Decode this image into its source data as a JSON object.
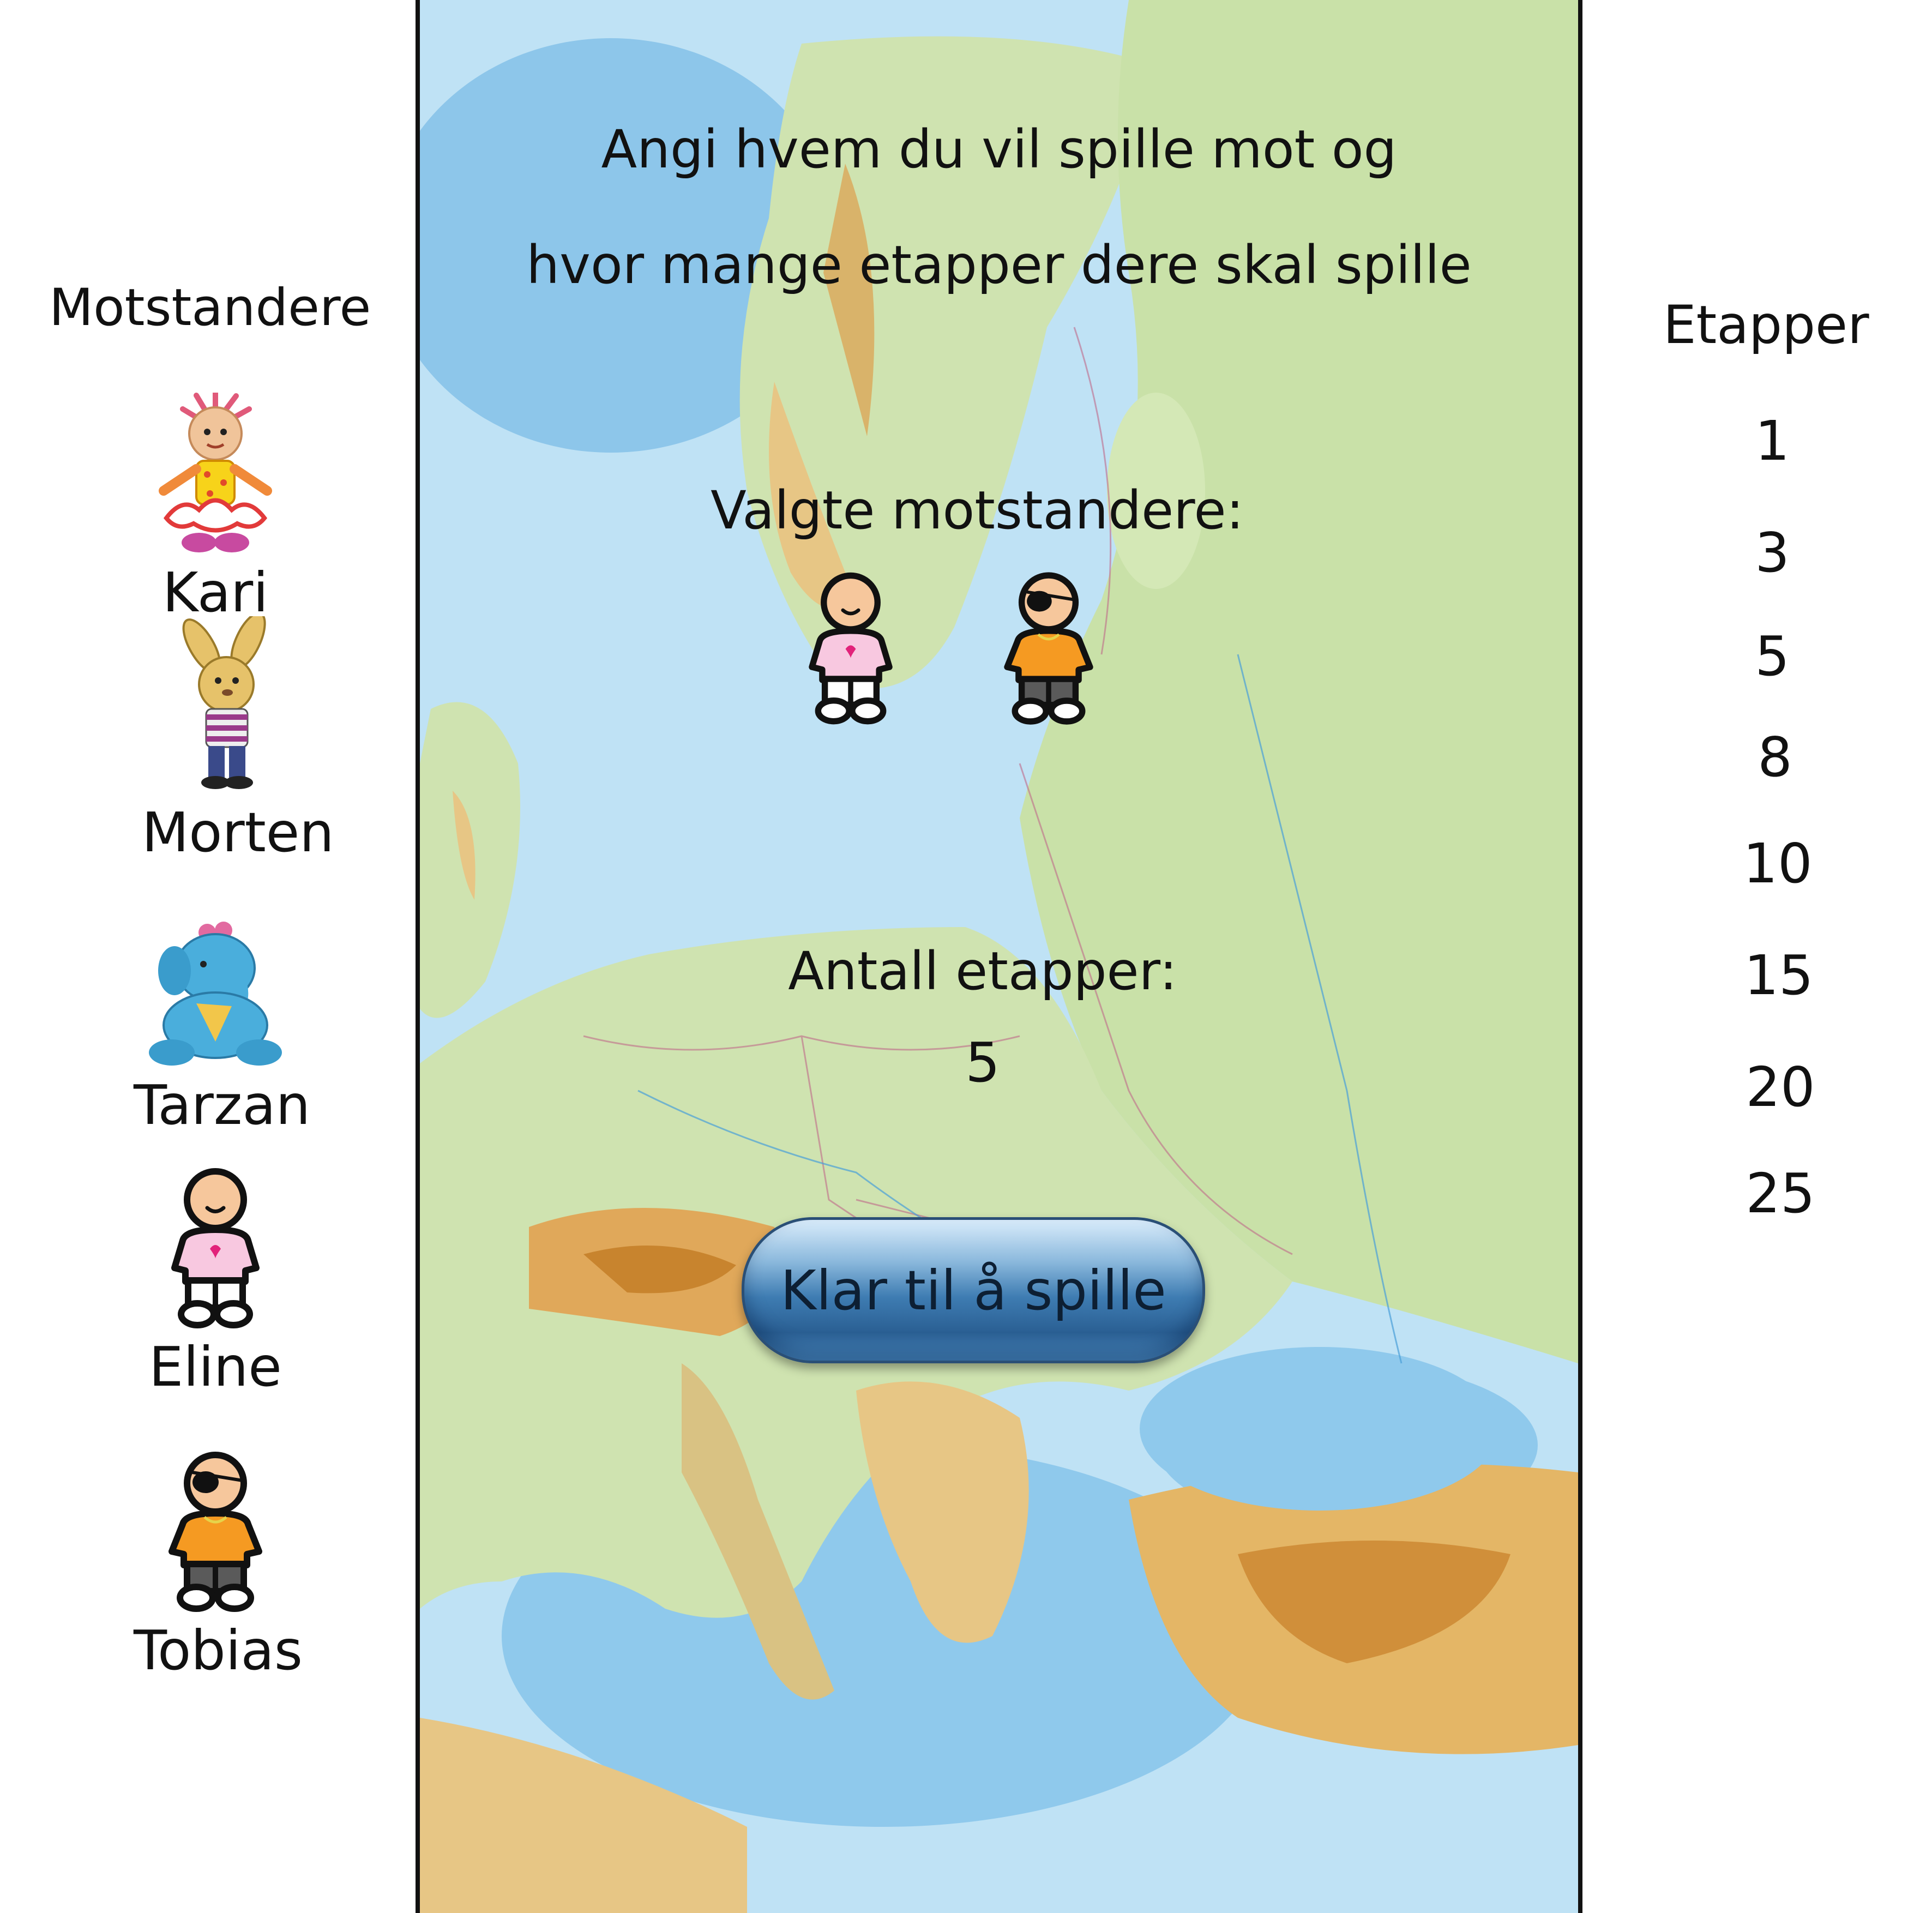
{
  "opponents_panel": {
    "title": "Motstandere",
    "opponents": [
      {
        "name": "Kari",
        "avatar": "doll-girl-icon"
      },
      {
        "name": "Morten",
        "avatar": "rabbit-icon"
      },
      {
        "name": "Tarzan",
        "avatar": "blue-elephant-icon"
      },
      {
        "name": "Eline",
        "avatar": "girl-pictogram-icon"
      },
      {
        "name": "Tobias",
        "avatar": "boy-eyepatch-pictogram-icon"
      }
    ]
  },
  "center": {
    "instruction_line1": "Angi hvem du vil spille mot og",
    "instruction_line2": "hvor mange etapper dere skal spille",
    "selected_title": "Valgte motstandere:",
    "selected_opponents": [
      "girl-pictogram-icon",
      "boy-eyepatch-pictogram-icon"
    ],
    "stages_title": "Antall etapper:",
    "stages_value": "5",
    "play_button": "Klar til å spille"
  },
  "stages_panel": {
    "title": "Etapper",
    "options": [
      "1",
      "3",
      "5",
      "8",
      "10",
      "15",
      "20",
      "25"
    ]
  },
  "colors": {
    "sea": "#b9def3",
    "land": "#cfe3b0",
    "button": "#3e7cb2"
  }
}
